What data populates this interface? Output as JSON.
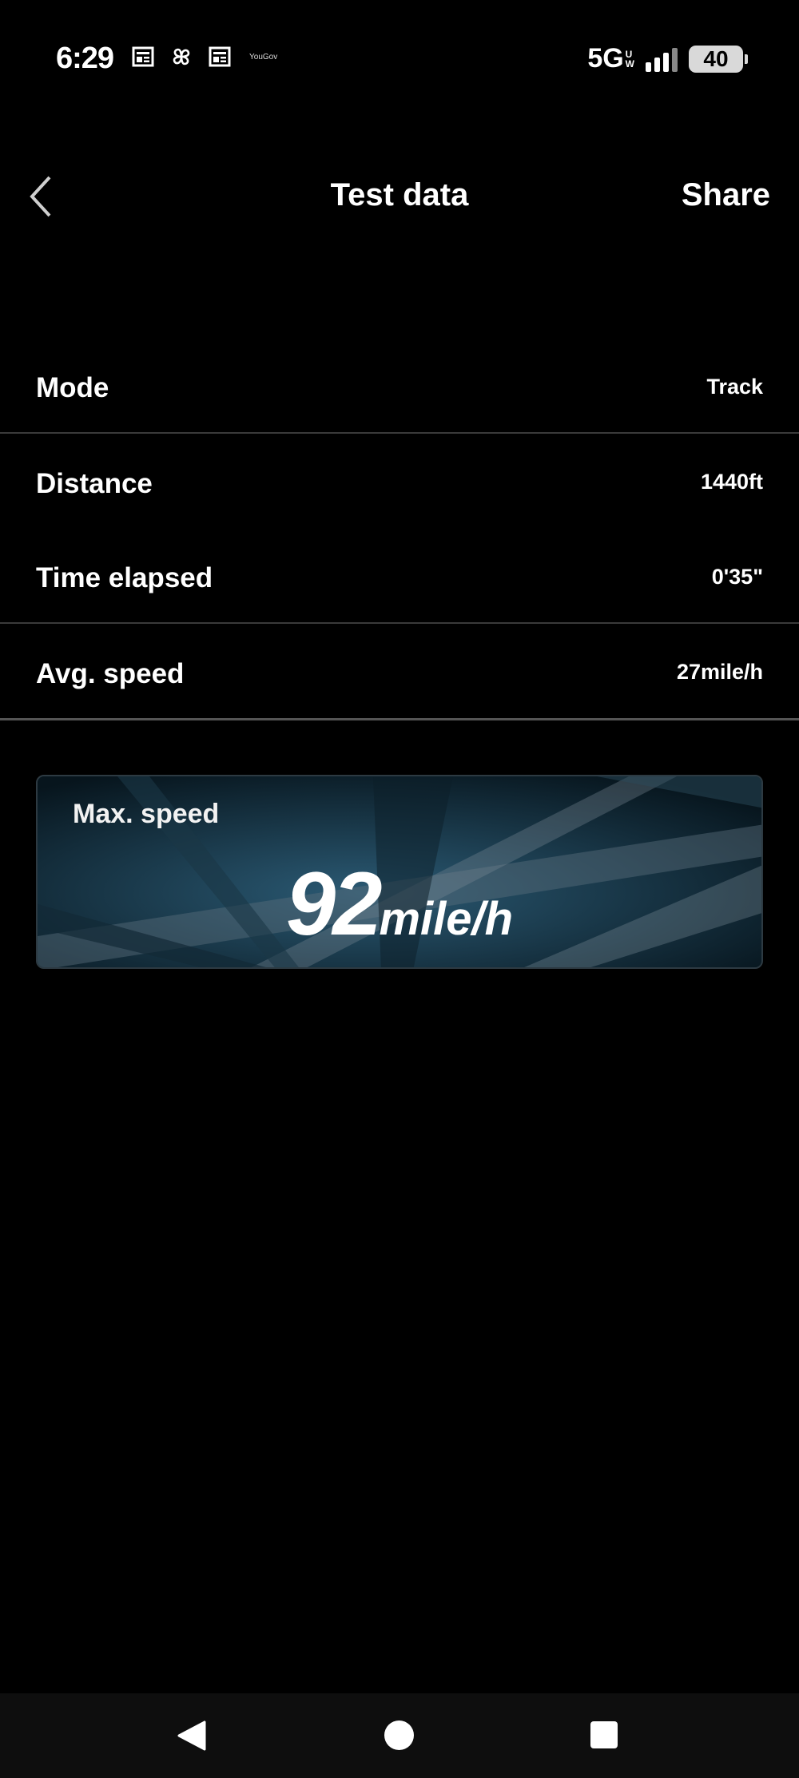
{
  "status_bar": {
    "time": "6:29",
    "yougov_label": "YouGov",
    "network": "5G",
    "network_sub_top": "U",
    "network_sub_bottom": "W",
    "battery": "40"
  },
  "header": {
    "title": "Test data",
    "share_label": "Share"
  },
  "rows": [
    {
      "label": "Mode",
      "value": "Track"
    },
    {
      "label": "Distance",
      "value": "1440ft"
    },
    {
      "label": "Time elapsed",
      "value": "0'35\""
    },
    {
      "label": "Avg. speed",
      "value": "27mile/h"
    }
  ],
  "max_speed": {
    "label": "Max. speed",
    "value": "92",
    "unit": "mile/h"
  },
  "colors": {
    "background": "#000000",
    "card_bg": "#0b1f2a",
    "divider": "#3a3a3a",
    "text": "#ffffff"
  },
  "icons": [
    "back-chevron-icon",
    "news-icon",
    "pinwheel-icon",
    "signal-icon",
    "battery-icon",
    "nav-back-icon",
    "nav-home-icon",
    "nav-recents-icon"
  ]
}
